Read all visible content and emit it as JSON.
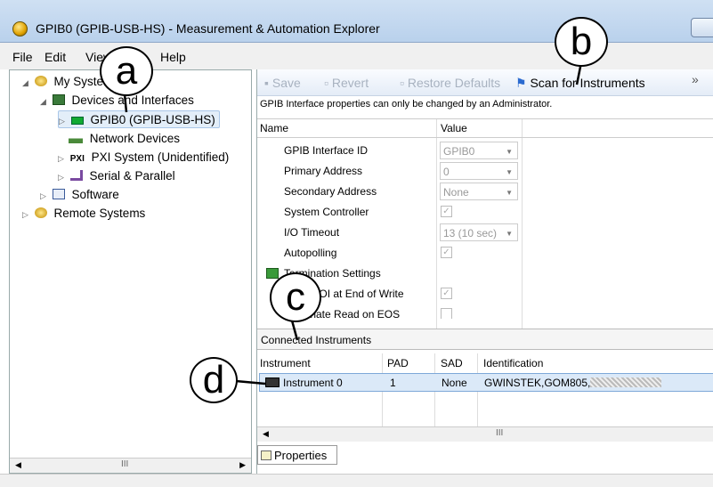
{
  "window": {
    "title": "GPIB0 (GPIB-USB-HS) - Measurement & Automation Explorer"
  },
  "menu": [
    "File",
    "Edit",
    "View",
    "Help"
  ],
  "tree": {
    "my_system": "My System",
    "devices": "Devices and Interfaces",
    "gpib": "GPIB0 (GPIB-USB-HS)",
    "network": "Network Devices",
    "pxi": "PXI System (Unidentified)",
    "serial": "Serial & Parallel",
    "software": "Software",
    "remote": "Remote Systems"
  },
  "toolbar": {
    "save": "Save",
    "revert": "Revert",
    "restore": "Restore Defaults",
    "scan": "Scan for Instruments",
    "more": "»"
  },
  "notice": "GPIB Interface properties can only be changed by an Administrator.",
  "properties": {
    "headers": {
      "name": "Name",
      "value": "Value"
    },
    "rows": [
      {
        "name": "GPIB Interface ID",
        "value": "GPIB0"
      },
      {
        "name": "Primary Address",
        "value": "0"
      },
      {
        "name": "Secondary Address",
        "value": "None"
      },
      {
        "name": "System Controller",
        "value": "✓"
      },
      {
        "name": "I/O Timeout",
        "value": "13 (10 sec)"
      },
      {
        "name": "Autopolling",
        "value": "✓"
      },
      {
        "name": "Termination Settings",
        "value": ""
      },
      {
        "name": "Send EOI at End of Write",
        "value": "✓"
      },
      {
        "name": "Terminate Read on EOS",
        "value": ""
      }
    ]
  },
  "connected": {
    "label": "Connected Instruments",
    "headers": {
      "instrument": "Instrument",
      "pad": "PAD",
      "sad": "SAD",
      "identification": "Identification"
    },
    "rows": [
      {
        "instrument": "Instrument 0",
        "pad": "1",
        "sad": "None",
        "identification": "GWINSTEK,GOM805,"
      }
    ]
  },
  "tabs": {
    "properties": "Properties"
  },
  "callouts": {
    "a": "a",
    "b": "b",
    "c": "c",
    "d": "d"
  },
  "scroll_thumb": "III"
}
